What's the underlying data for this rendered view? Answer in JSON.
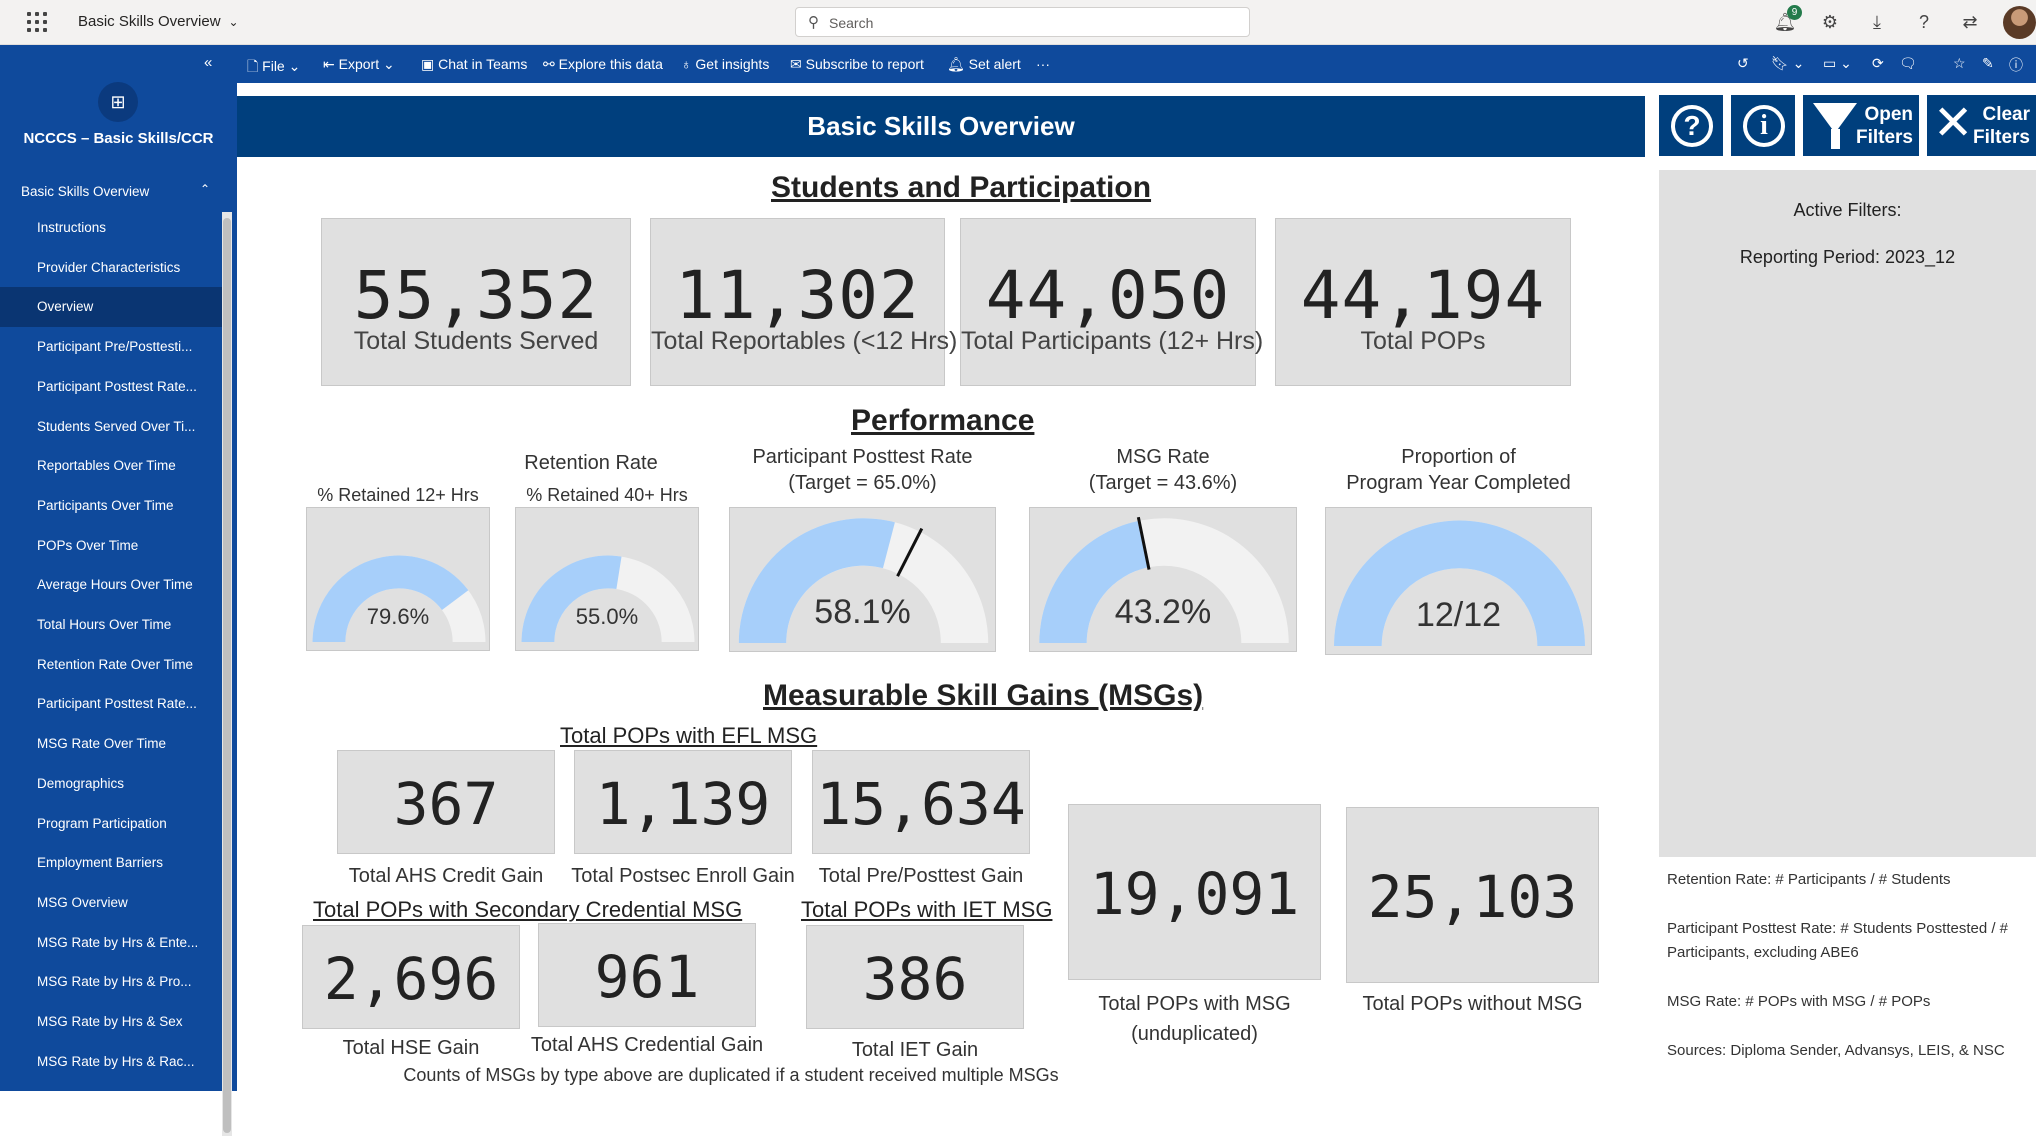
{
  "app": {
    "title": "Basic Skills Overview"
  },
  "search": {
    "placeholder": "Search"
  },
  "notifications": {
    "count": "9"
  },
  "workspace": {
    "name": "NCCCS – Basic Skills/CCR"
  },
  "nav": {
    "section": "Basic Skills Overview",
    "items": [
      {
        "label": "Instructions"
      },
      {
        "label": "Provider Characteristics"
      },
      {
        "label": "Overview",
        "active": true
      },
      {
        "label": "Participant Pre/Posttesti..."
      },
      {
        "label": "Participant Posttest Rate..."
      },
      {
        "label": "Students Served Over Ti..."
      },
      {
        "label": "Reportables Over Time"
      },
      {
        "label": "Participants Over Time"
      },
      {
        "label": "POPs Over Time"
      },
      {
        "label": "Average Hours Over Time"
      },
      {
        "label": "Total Hours Over Time"
      },
      {
        "label": "Retention Rate Over Time"
      },
      {
        "label": "Participant Posttest Rate..."
      },
      {
        "label": "MSG Rate Over Time"
      },
      {
        "label": "Demographics"
      },
      {
        "label": "Program Participation"
      },
      {
        "label": "Employment Barriers"
      },
      {
        "label": "MSG Overview"
      },
      {
        "label": "MSG Rate by Hrs & Ente..."
      },
      {
        "label": "MSG Rate by Hrs & Pro..."
      },
      {
        "label": "MSG Rate by Hrs & Sex"
      },
      {
        "label": "MSG Rate by Hrs & Rac..."
      }
    ]
  },
  "actions": {
    "file": "File",
    "export": "Export",
    "chat": "Chat in Teams",
    "explore": "Explore this data",
    "insights": "Get insights",
    "subscribe": "Subscribe to report",
    "alert": "Set alert",
    "more": "···"
  },
  "report": {
    "header": "Basic Skills Overview",
    "buttons": {
      "help": "?",
      "info": "i",
      "open_filters": [
        "Open",
        "Filters"
      ],
      "clear_filters": [
        "Clear",
        "Filters"
      ]
    },
    "students": {
      "title": "Students and Participation",
      "kpis": [
        {
          "value": "55,352",
          "label": "Total Students Served"
        },
        {
          "value": "11,302",
          "label": "Total Reportables (<12 Hrs)"
        },
        {
          "value": "44,050",
          "label": "Total Participants (12+ Hrs)"
        },
        {
          "value": "44,194",
          "label": "Total POPs"
        }
      ]
    },
    "performance": {
      "title": "Performance",
      "retention_title": "Retention Rate",
      "gauges": [
        {
          "label": "% Retained 12+ Hrs",
          "value": "79.6%",
          "fraction": 0.796
        },
        {
          "label": "% Retained 40+ Hrs",
          "value": "55.0%",
          "fraction": 0.55
        },
        {
          "label": [
            "Participant Posttest Rate",
            "(Target = 65.0%)"
          ],
          "value": "58.1%",
          "fraction": 0.581,
          "target": 0.65
        },
        {
          "label": [
            "MSG Rate",
            "(Target = 43.6%)"
          ],
          "value": "43.2%",
          "fraction": 0.432,
          "target": 0.436
        },
        {
          "label": [
            "Proportion of",
            "Program Year Completed"
          ],
          "value": "12/12",
          "fraction": 1.0
        }
      ]
    },
    "msg": {
      "title": "Measurable Skill Gains (MSGs)",
      "efl_title": "Total POPs with EFL MSG",
      "secondary_title": "Total POPs with Secondary Credential MSG",
      "iet_title": "Total POPs with IET MSG",
      "kpis": {
        "ahs_credit": {
          "value": "367",
          "label": "Total AHS Credit Gain"
        },
        "postsec": {
          "value": "1,139",
          "label": "Total Postsec Enroll Gain"
        },
        "prepost": {
          "value": "15,634",
          "label": "Total Pre/Posttest Gain"
        },
        "hse": {
          "value": "2,696",
          "label": "Total HSE Gain"
        },
        "ahs_cred": {
          "value": "961",
          "label": "Total AHS Credential Gain"
        },
        "iet": {
          "value": "386",
          "label": "Total IET Gain"
        },
        "with_msg": {
          "value": "19,091",
          "label": [
            "Total POPs with MSG",
            "(unduplicated)"
          ]
        },
        "without_msg": {
          "value": "25,103",
          "label": "Total POPs without MSG"
        }
      },
      "footnote": "Counts of MSGs by type above are duplicated if a student received multiple MSGs"
    },
    "filters": {
      "title": "Active Filters:",
      "period": "Reporting Period: 2023_12"
    },
    "notes": {
      "retention": "Retention Rate: # Participants / # Students",
      "posttest": "Participant Posttest Rate: # Students Posttested / # Participants, excluding ABE6",
      "msg": "MSG Rate: # POPs with MSG / # POPs",
      "sources": "Sources: Diploma Sender, Advansys, LEIS, & NSC"
    }
  },
  "colors": {
    "nav": "#0f4a9c",
    "header": "#003f7d",
    "gauge_fill": "#a7cffa",
    "gauge_track": "#f2f2f2",
    "card": "#e0e0e0"
  },
  "icons": [
    "waffle-icon",
    "search-icon",
    "bell-icon",
    "settings-icon",
    "download-icon",
    "help-icon",
    "share-icon",
    "collapse-icon",
    "refresh-icon",
    "bookmark-icon",
    "view-icon",
    "reload-icon",
    "comment-icon",
    "favorite-icon",
    "edit-icon",
    "info-icon"
  ]
}
